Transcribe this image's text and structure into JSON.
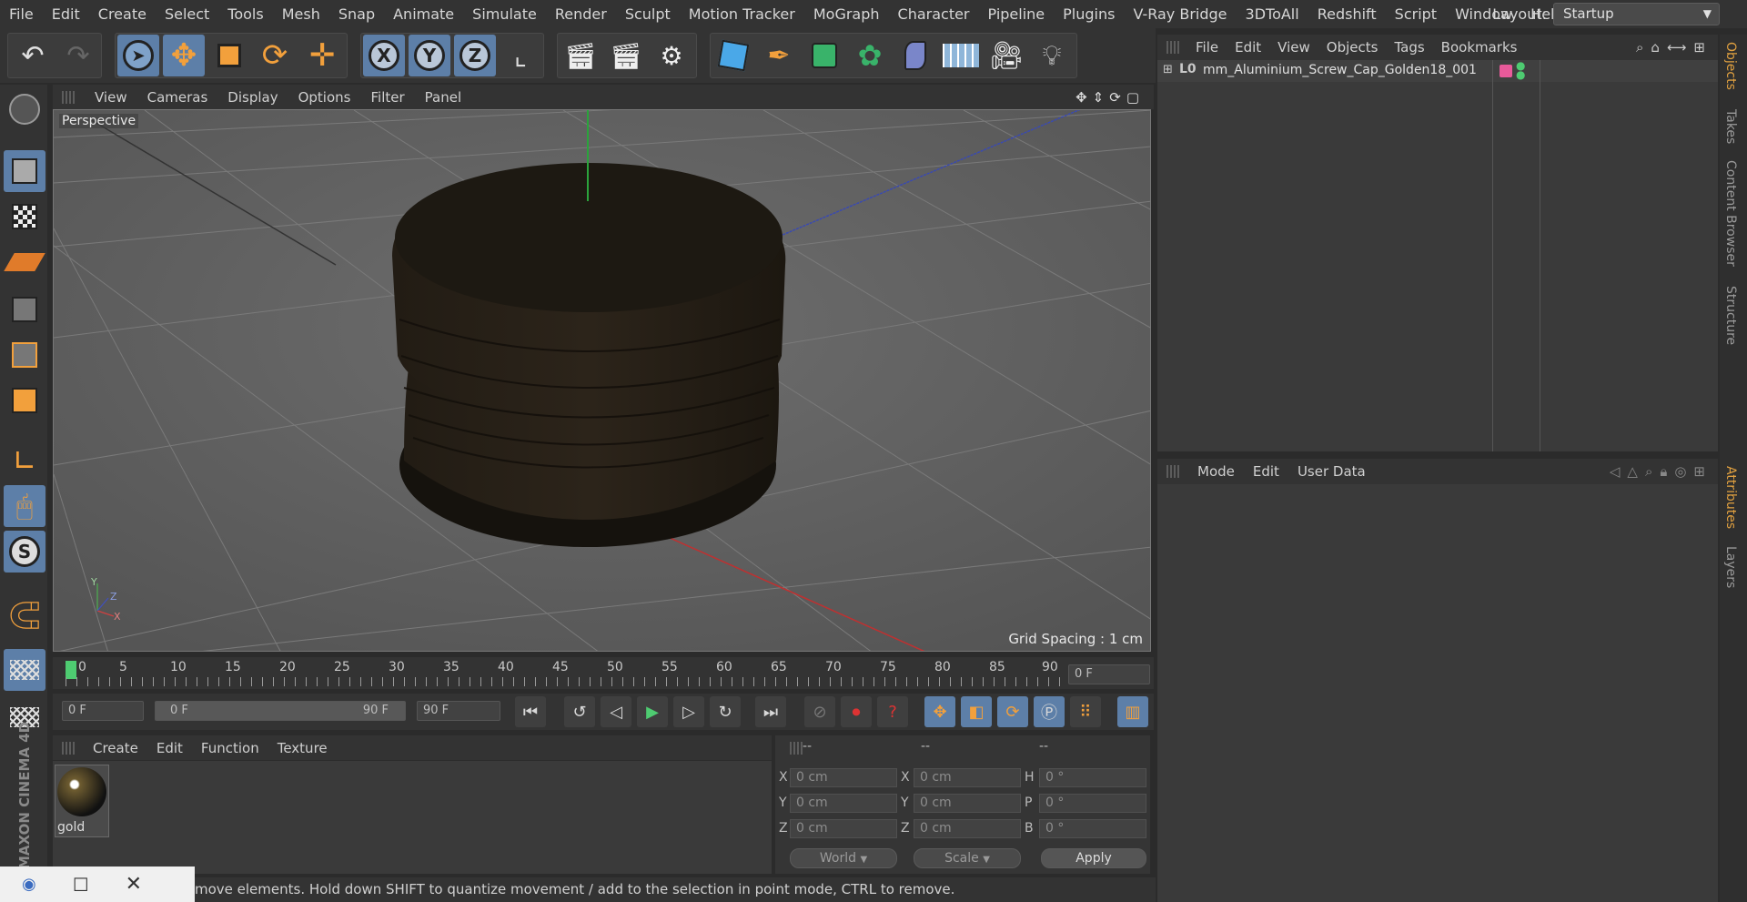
{
  "menubar": {
    "items": [
      "File",
      "Edit",
      "Create",
      "Select",
      "Tools",
      "Mesh",
      "Snap",
      "Animate",
      "Simulate",
      "Render",
      "Sculpt",
      "Motion Tracker",
      "MoGraph",
      "Character",
      "Pipeline",
      "Plugins",
      "V-Ray Bridge",
      "3DToAll",
      "Redshift",
      "Script",
      "Window",
      "Help"
    ],
    "layout_label": "Layout:",
    "layout_value": "Startup"
  },
  "toolbar": {
    "axis_x": "X",
    "axis_y": "Y",
    "axis_z": "Z"
  },
  "viewport": {
    "menu": [
      "View",
      "Cameras",
      "Display",
      "Options",
      "Filter",
      "Panel"
    ],
    "camera_label": "Perspective",
    "grid_spacing": "Grid Spacing : 1 cm",
    "axis_y": "Y",
    "axis_z": "Z",
    "axis_x": "X"
  },
  "timeline": {
    "ticks": [
      "0",
      "5",
      "10",
      "15",
      "20",
      "25",
      "30",
      "35",
      "40",
      "45",
      "50",
      "55",
      "60",
      "65",
      "70",
      "75",
      "80",
      "85",
      "90"
    ],
    "current_frame": "0 F"
  },
  "timectrl": {
    "start": "0 F",
    "range_start": "0 F",
    "range_end": "90 F",
    "end": "90 F"
  },
  "materials": {
    "menu": [
      "Create",
      "Edit",
      "Function",
      "Texture"
    ],
    "items": [
      {
        "name": "gold"
      }
    ]
  },
  "coords": {
    "header": [
      "--",
      "--",
      "--"
    ],
    "rows": [
      {
        "l1": "X",
        "v1": "0 cm",
        "l2": "X",
        "v2": "0 cm",
        "l3": "H",
        "v3": "0 °"
      },
      {
        "l1": "Y",
        "v1": "0 cm",
        "l2": "Y",
        "v2": "0 cm",
        "l3": "P",
        "v3": "0 °"
      },
      {
        "l1": "Z",
        "v1": "0 cm",
        "l2": "Z",
        "v2": "0 cm",
        "l3": "B",
        "v3": "0 °"
      }
    ],
    "world": "World",
    "scale": "Scale",
    "apply": "Apply"
  },
  "statusbar": {
    "text": "move elements. Hold down SHIFT to quantize movement / add to the selection in point mode, CTRL to remove."
  },
  "objects": {
    "menu": [
      "File",
      "Edit",
      "View",
      "Objects",
      "Tags",
      "Bookmarks"
    ],
    "items": [
      {
        "name": "mm_Aluminium_Screw_Cap_Golden18_001"
      }
    ]
  },
  "attributes": {
    "menu": [
      "Mode",
      "Edit",
      "User Data"
    ]
  },
  "side_tabs": [
    "Objects",
    "Takes",
    "Content Browser",
    "Structure",
    "Attributes",
    "Layers"
  ],
  "branding": {
    "logo_text": "MAXON CINEMA 4D"
  },
  "colors": {
    "accent": "#5d7fa8",
    "active_tab": "#e0a040",
    "tag_pink": "#e85a9a",
    "tag_green": "#4ecb71"
  }
}
